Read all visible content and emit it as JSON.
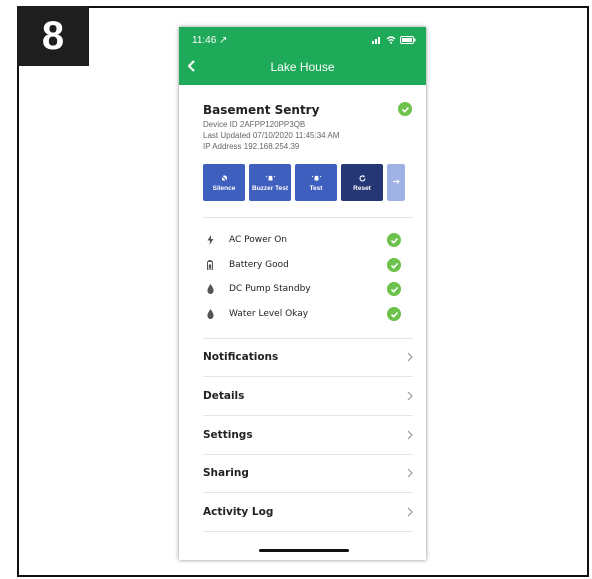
{
  "step_number": "8",
  "status_bar": {
    "time": "11:46 ↗"
  },
  "nav": {
    "title": "Lake House"
  },
  "device": {
    "name": "Basement Sentry",
    "device_id": "Device ID 2AFPP120PP3QB",
    "last_updated": "Last Updated 07/10/2020 11:45:34 AM",
    "ip_address": "IP Address 192.168.254.39"
  },
  "actions": [
    {
      "label": "Silence"
    },
    {
      "label": "Buzzer Test"
    },
    {
      "label": "Test"
    },
    {
      "label": "Reset"
    }
  ],
  "statuses": [
    {
      "label": "AC Power On"
    },
    {
      "label": "Battery Good"
    },
    {
      "label": "DC Pump Standby"
    },
    {
      "label": "Water Level Okay"
    }
  ],
  "menu": [
    {
      "label": "Notifications"
    },
    {
      "label": "Details"
    },
    {
      "label": "Settings"
    },
    {
      "label": "Sharing"
    },
    {
      "label": "Activity Log"
    }
  ],
  "colors": {
    "header_green": "#1faa59",
    "check_green": "#6cc24a",
    "button_blue": "#3f5fbf",
    "button_dark": "#263775"
  }
}
